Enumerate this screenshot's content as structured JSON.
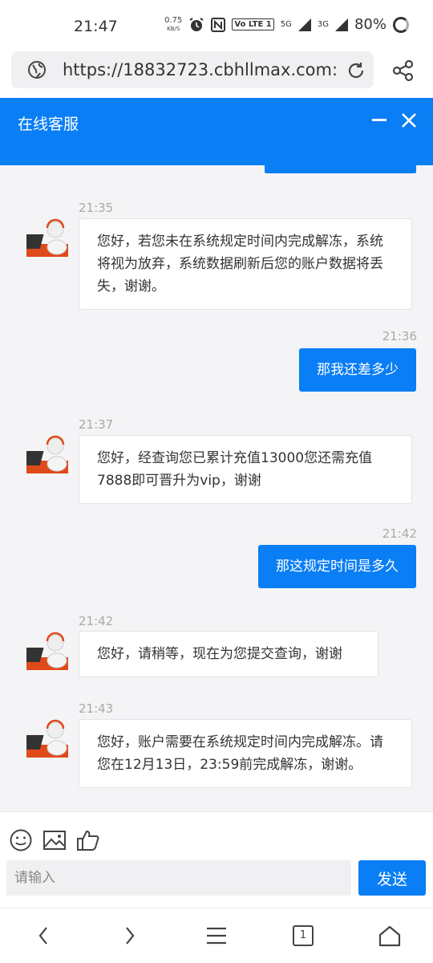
{
  "status_bar": {
    "time": "21:47",
    "net_speed": "0.75",
    "net_unit": "KB/S",
    "volte": "Vo LTE 1",
    "signal1": "5G",
    "signal2": "3G",
    "battery": "80%"
  },
  "browser": {
    "url": "https://18832723.cbhllmax.com:"
  },
  "header": {
    "title": "在线客服"
  },
  "messages": [
    {
      "side": "left",
      "time": "21:35",
      "text": "您好，若您未在系统规定时间内完成解冻，系统将视为放弃，系统数据刷新后您的账户数据将丢失，谢谢。"
    },
    {
      "side": "right",
      "time": "21:36",
      "text": "那我还差多少"
    },
    {
      "side": "left",
      "time": "21:37",
      "text": "您好，经查询您已累计充值13000您还需充值7888即可晋升为vip，谢谢"
    },
    {
      "side": "right",
      "time": "21:42",
      "text": "那这规定时间是多久"
    },
    {
      "side": "left",
      "time": "21:42",
      "text": "您好，请稍等，现在为您提交查询，谢谢"
    },
    {
      "side": "left",
      "time": "21:43",
      "text": "您好，账户需要在系统规定时间内完成解冻。请您在12月13日，23:59前完成解冻，谢谢。"
    }
  ],
  "input": {
    "placeholder": "请输入",
    "value": "",
    "send_label": "发送"
  },
  "nav": {
    "tab_count": "1"
  },
  "colors": {
    "accent": "#0a7ef5",
    "background": "#f4f4f6"
  }
}
